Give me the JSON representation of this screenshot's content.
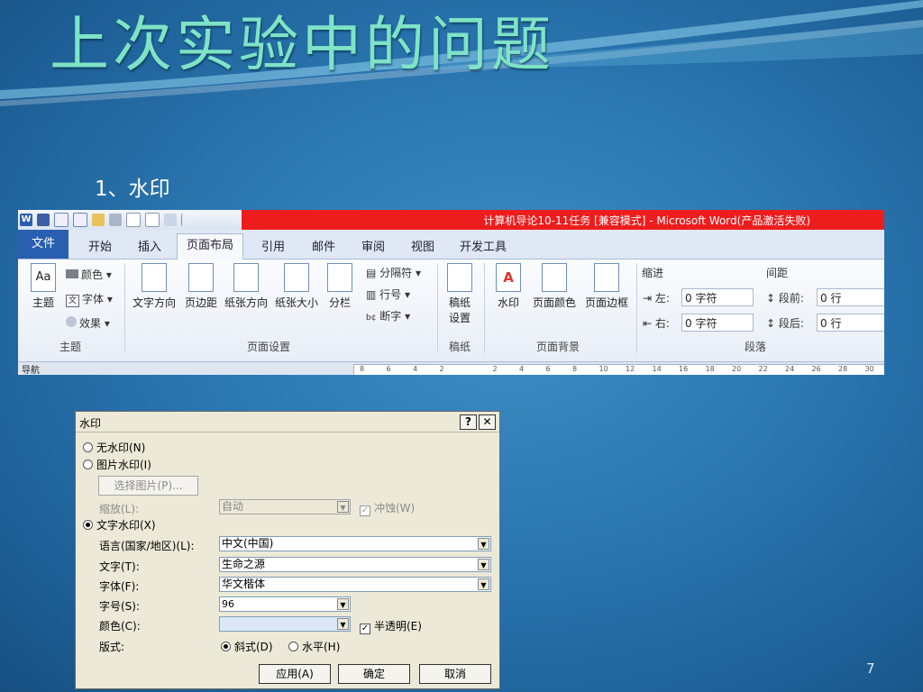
{
  "slide": {
    "title": "上次实验中的问题",
    "bullet": "1、水印",
    "page": "7"
  },
  "word": {
    "window_title": "计算机导论10-11任务 [兼容模式] - Microsoft Word(产品激活失败)",
    "tabs": [
      "文件",
      "开始",
      "插入",
      "页面布局",
      "引用",
      "邮件",
      "审阅",
      "视图",
      "开发工具"
    ],
    "theme": {
      "colors": "颜色",
      "fonts": "字体",
      "effects": "效果",
      "theme": "主题",
      "group": "主题"
    },
    "page_setup": {
      "text_direction": "文字方向",
      "margins": "页边距",
      "orientation": "纸张方向",
      "size": "纸张大小",
      "columns": "分栏",
      "breaks": "分隔符",
      "line_numbers": "行号",
      "hyphenation": "断字",
      "group": "页面设置"
    },
    "draft": {
      "label1": "稿纸",
      "label2": "设置",
      "group": "稿纸"
    },
    "background": {
      "watermark": "水印",
      "page_color": "页面颜色",
      "page_borders": "页面边框",
      "group": "页面背景"
    },
    "paragraph": {
      "indent": "缩进",
      "left_label": "左:",
      "left_val": "0 字符",
      "right_label": "右:",
      "right_val": "0 字符",
      "spacing": "间距",
      "before_label": "段前:",
      "before_val": "0 行",
      "after_label": "段后:",
      "after_val": "0 行",
      "group": "段落"
    },
    "nav": "导航",
    "ruler": [
      "8",
      "6",
      "4",
      "2",
      "",
      "2",
      "4",
      "6",
      "8",
      "10",
      "12",
      "14",
      "16",
      "18",
      "20",
      "22",
      "24",
      "26",
      "28",
      "30"
    ]
  },
  "dialog": {
    "title": "水印",
    "help": "?",
    "close": "✕",
    "no_watermark": "无水印(N)",
    "picture_watermark": "图片水印(I)",
    "select_picture": "选择图片(P)...",
    "scale_label": "缩放(L):",
    "scale_val": "自动",
    "washout": "冲蚀(W)",
    "text_watermark": "文字水印(X)",
    "language_label": "语言(国家/地区)(L):",
    "language_val": "中文(中国)",
    "text_label": "文字(T):",
    "text_val": "生命之源",
    "font_label": "字体(F):",
    "font_val": "华文楷体",
    "size_label": "字号(S):",
    "size_val": "96",
    "color_label": "颜色(C):",
    "color_val": "",
    "semitransparent": "半透明(E)",
    "layout_label": "版式:",
    "diagonal": "斜式(D)",
    "horizontal": "水平(H)",
    "apply": "应用(A)",
    "ok": "确定",
    "cancel": "取消"
  }
}
